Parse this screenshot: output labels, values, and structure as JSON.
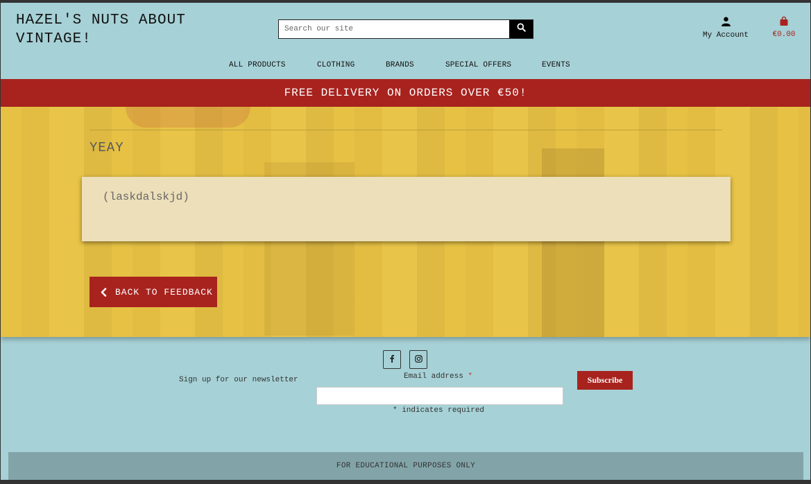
{
  "header": {
    "brand": "HAZEL'S NUTS ABOUT VINTAGE!",
    "search_placeholder": "Search our site",
    "account_label": "My Account",
    "cart_total": "€0.00"
  },
  "nav": {
    "items": [
      {
        "label": "ALL PRODUCTS"
      },
      {
        "label": "CLOTHING"
      },
      {
        "label": "BRANDS"
      },
      {
        "label": "SPECIAL OFFERS"
      },
      {
        "label": "EVENTS"
      }
    ]
  },
  "banner": {
    "text": "FREE DELIVERY ON ORDERS OVER €50!"
  },
  "main": {
    "heading": "YEAY",
    "feedback_body": "(laskdalskjd)",
    "back_button": "BACK TO FEEDBACK"
  },
  "footer": {
    "social": [
      "facebook-icon",
      "instagram-icon"
    ],
    "newsletter_label": "Sign up for our newsletter",
    "email_label": "Email address",
    "required_star": "*",
    "subscribe_label": "Subscribe",
    "required_note": "* indicates required",
    "edu_note": "FOR EDUCATIONAL PURPOSES ONLY"
  },
  "colors": {
    "accent_red": "#a8231e",
    "background_teal": "#a6d1d6",
    "card_cream": "#ecdfb9"
  }
}
